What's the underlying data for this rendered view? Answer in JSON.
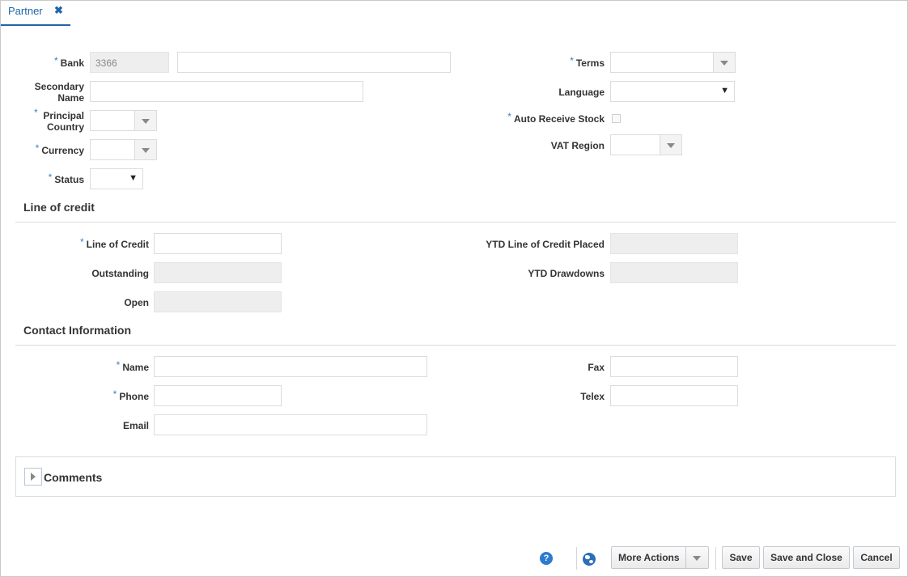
{
  "tab": {
    "label": "Partner",
    "close_glyph": "✖"
  },
  "form": {
    "bank": {
      "label": "Bank",
      "value": "3366",
      "description": ""
    },
    "secondary_name": {
      "label": "Secondary\nName",
      "value": ""
    },
    "principal_country": {
      "label": "Principal\nCountry",
      "value": ""
    },
    "currency": {
      "label": "Currency",
      "value": ""
    },
    "status": {
      "label": "Status",
      "value": ""
    },
    "terms": {
      "label": "Terms",
      "value": ""
    },
    "language": {
      "label": "Language",
      "value": ""
    },
    "auto_receive_stock": {
      "label": "Auto Receive Stock",
      "checked": false
    },
    "vat_region": {
      "label": "VAT Region",
      "value": ""
    }
  },
  "line_of_credit": {
    "title": "Line of credit",
    "line_of_credit": {
      "label": "Line of Credit",
      "value": ""
    },
    "outstanding": {
      "label": "Outstanding",
      "value": ""
    },
    "open": {
      "label": "Open",
      "value": ""
    },
    "ytd_placed": {
      "label": "YTD Line of Credit Placed",
      "value": ""
    },
    "ytd_drawdowns": {
      "label": "YTD Drawdowns",
      "value": ""
    }
  },
  "contact": {
    "title": "Contact Information",
    "name": {
      "label": "Name",
      "value": ""
    },
    "phone": {
      "label": "Phone",
      "value": ""
    },
    "email": {
      "label": "Email",
      "value": ""
    },
    "fax": {
      "label": "Fax",
      "value": ""
    },
    "telex": {
      "label": "Telex",
      "value": ""
    }
  },
  "comments": {
    "label": "Comments"
  },
  "footer": {
    "help_glyph": "?",
    "more_actions": "More Actions",
    "save": "Save",
    "save_and_close": "Save and Close",
    "cancel": "Cancel"
  },
  "required_marker": "*",
  "icons": [
    "close-icon",
    "dropdown-arrow-icon",
    "expand-icon",
    "help-icon",
    "globe-icon"
  ],
  "colors": {
    "accent": "#1f66a7",
    "required": "#3d7fc4",
    "readonly_bg": "#eeeeee"
  }
}
